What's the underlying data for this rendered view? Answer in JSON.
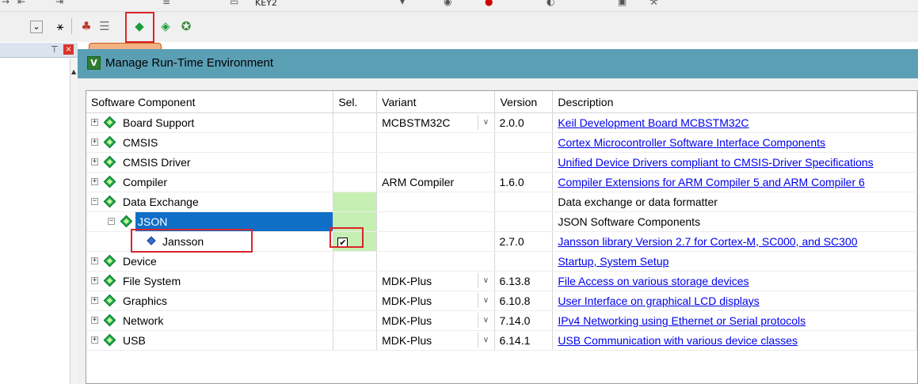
{
  "toolbar_top": {
    "target_label": "KEY2"
  },
  "dialog": {
    "title": "Manage Run-Time Environment",
    "columns": {
      "component": "Software Component",
      "sel": "Sel.",
      "variant": "Variant",
      "version": "Version",
      "description": "Description"
    },
    "rows": [
      {
        "name": "Board Support",
        "variant": "MCBSTM32C",
        "version": "2.0.0",
        "description": "Keil Development Board MCBSTM32C"
      },
      {
        "name": "CMSIS",
        "variant": "",
        "version": "",
        "description": "Cortex Microcontroller Software Interface Components"
      },
      {
        "name": "CMSIS Driver",
        "variant": "",
        "version": "",
        "description": "Unified Device Drivers compliant to CMSIS-Driver Specifications"
      },
      {
        "name": "Compiler",
        "variant": "ARM Compiler",
        "version": "1.6.0",
        "description": "Compiler Extensions for ARM Compiler 5 and ARM Compiler 6"
      },
      {
        "name": "Data Exchange",
        "variant": "",
        "version": "",
        "description": "Data exchange or data formatter"
      },
      {
        "name": "JSON",
        "variant": "",
        "version": "",
        "description": "JSON Software Components"
      },
      {
        "name": "Jansson",
        "variant": "",
        "version": "2.7.0",
        "description": "Jansson library Version 2.7 for Cortex-M, SC000, and SC300",
        "checked": true
      },
      {
        "name": "Device",
        "variant": "",
        "version": "",
        "description": "Startup, System Setup"
      },
      {
        "name": "File System",
        "variant": "MDK-Plus",
        "version": "6.13.8",
        "description": "File Access on various storage devices"
      },
      {
        "name": "Graphics",
        "variant": "MDK-Plus",
        "version": "6.10.8",
        "description": "User Interface on graphical LCD displays"
      },
      {
        "name": "Network",
        "variant": "MDK-Plus",
        "version": "7.14.0",
        "description": "IPv4 Networking using Ethernet or Serial protocols"
      },
      {
        "name": "USB",
        "variant": "MDK-Plus",
        "version": "6.14.1",
        "description": "USB Communication with various device classes"
      }
    ],
    "check_mark": "✔"
  },
  "icons": {
    "app": "rte-app-icon",
    "component": "green-diamond-icon",
    "subcomponent": "blue-diamond-icon"
  }
}
